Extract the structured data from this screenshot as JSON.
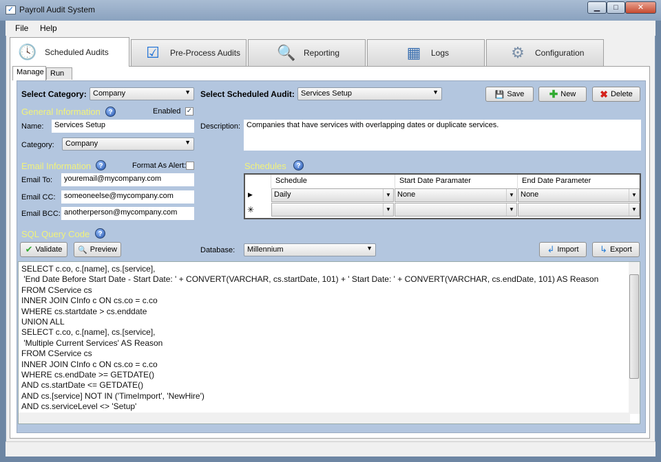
{
  "window": {
    "title": "Payroll Audit System"
  },
  "menu": [
    "File",
    "Help"
  ],
  "main_tabs": [
    {
      "label": "Scheduled Audits",
      "icon": "clock-icon"
    },
    {
      "label": "Pre-Process Audits",
      "icon": "clipboard-check-icon"
    },
    {
      "label": "Reporting",
      "icon": "report-search-icon"
    },
    {
      "label": "Logs",
      "icon": "table-icon"
    },
    {
      "label": "Configuration",
      "icon": "gear-icon"
    }
  ],
  "sub_tabs": [
    "Manage",
    "Run"
  ],
  "top": {
    "select_category_label": "Select Category:",
    "select_category_value": "Company",
    "select_audit_label": "Select Scheduled Audit:",
    "select_audit_value": "Services Setup",
    "save": "Save",
    "new": "New",
    "delete": "Delete"
  },
  "general": {
    "heading": "General Information",
    "enabled_label": "Enabled",
    "enabled": true,
    "name_label": "Name:",
    "name_value": "Services Setup",
    "category_label": "Category:",
    "category_value": "Company",
    "description_label": "Description:",
    "description_value": "Companies that have services with overlapping dates or duplicate services."
  },
  "email": {
    "heading": "Email Information",
    "format_alert_label": "Format As Alert:",
    "format_alert": false,
    "to_label": "Email To:",
    "to_value": "youremail@mycompany.com",
    "cc_label": "Email CC:",
    "cc_value": "someoneelse@mycompany.com",
    "bcc_label": "Email BCC:",
    "bcc_value": "anotherperson@mycompany.com"
  },
  "schedules": {
    "heading": "Schedules",
    "columns": [
      "Schedule",
      "Start Date Paramater",
      "End Date Parameter"
    ],
    "rows": [
      [
        "Daily",
        "None",
        "None"
      ],
      [
        "",
        "",
        ""
      ]
    ]
  },
  "sql": {
    "heading": "SQL Query Code",
    "validate": "Validate",
    "preview": "Preview",
    "database_label": "Database:",
    "database_value": "Millennium",
    "import": "Import",
    "export": "Export",
    "code": "SELECT c.co, c.[name], cs.[service],\n 'End Date Before Start Date - Start Date: ' + CONVERT(VARCHAR, cs.startDate, 101) + ' Start Date: ' + CONVERT(VARCHAR, cs.endDate, 101) AS Reason\nFROM CService cs\nINNER JOIN CInfo c ON cs.co = c.co\nWHERE cs.startdate > cs.enddate\nUNION ALL\nSELECT c.co, c.[name], cs.[service],\n 'Multiple Current Services' AS Reason\nFROM CService cs\nINNER JOIN CInfo c ON cs.co = c.co\nWHERE cs.endDate >= GETDATE()\nAND cs.startDate <= GETDATE()\nAND cs.[service] NOT IN ('TimeImport', 'NewHire')\nAND cs.serviceLevel <> 'Setup'"
  }
}
